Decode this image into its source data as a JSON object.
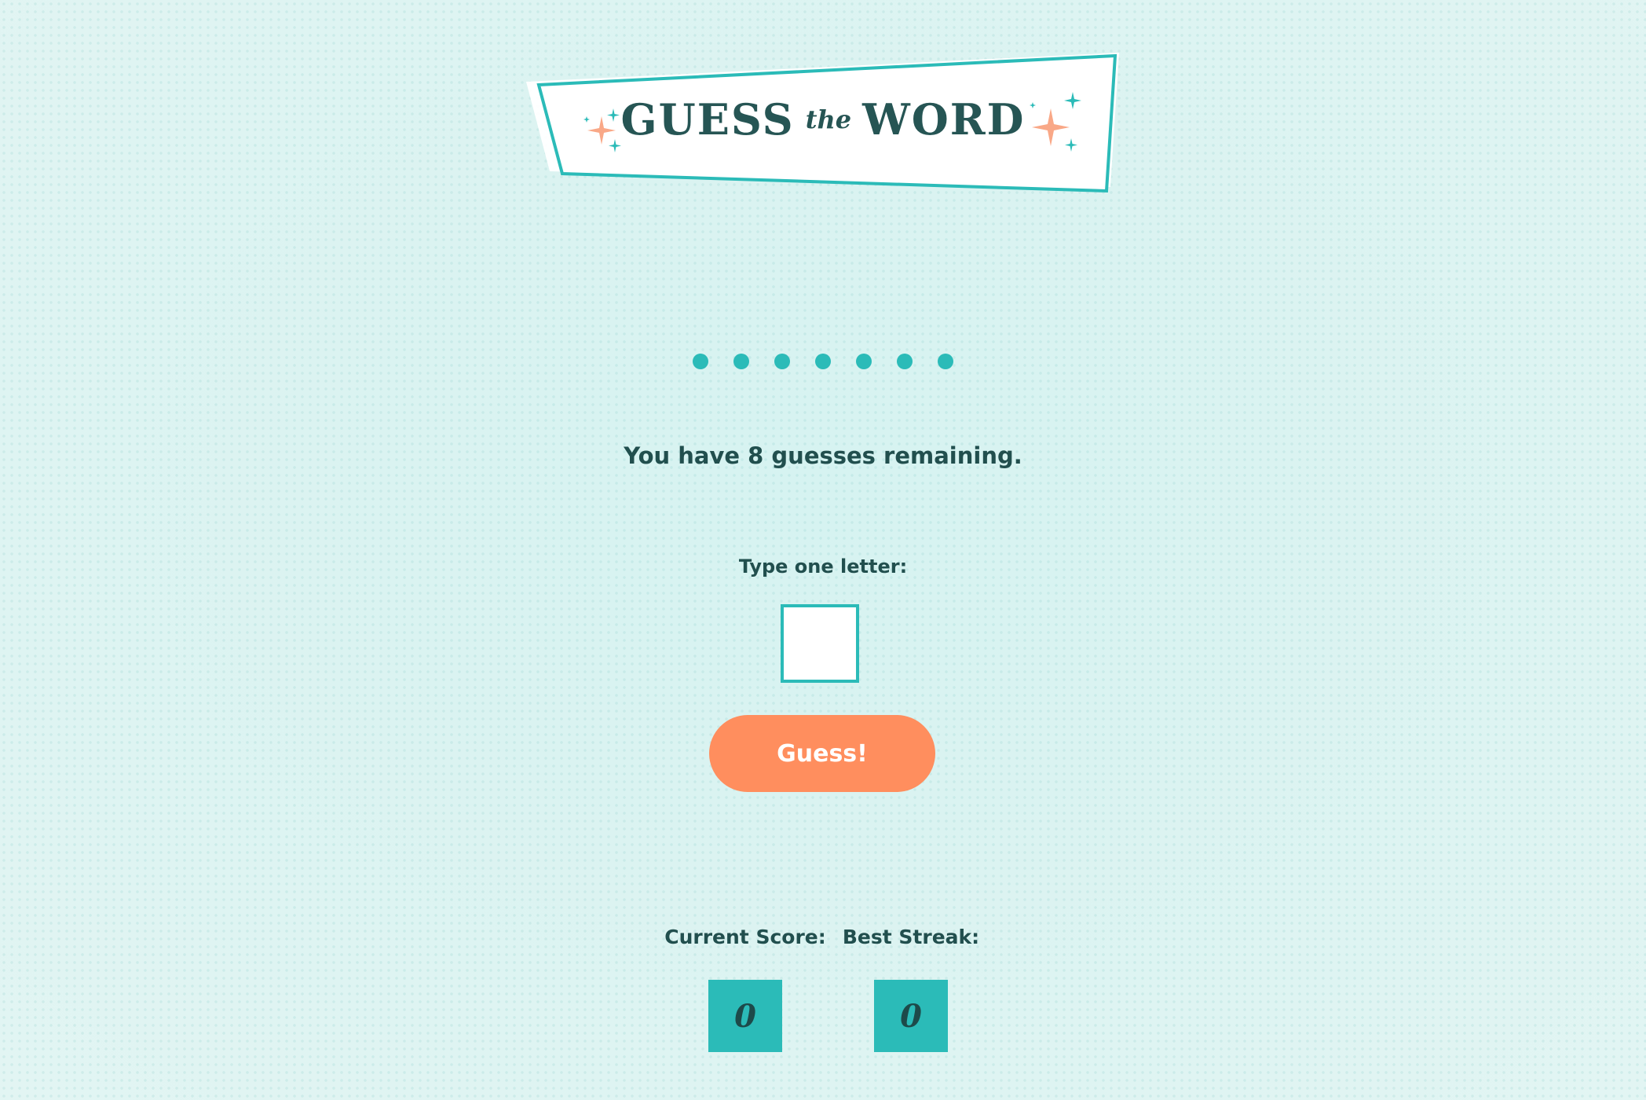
{
  "header": {
    "title_left": "GUESS",
    "title_middle": "the",
    "title_right": "WORD"
  },
  "word_progress": {
    "letters": [
      "•",
      "•",
      "•",
      "•",
      "•",
      "•",
      "•"
    ]
  },
  "status": {
    "remaining_text": "You have 8 guesses remaining."
  },
  "guess_form": {
    "label": "Type one letter:",
    "input_value": "",
    "button_label": "Guess!"
  },
  "scores": {
    "current_label": "Current Score:",
    "current_value": "0",
    "best_label": "Best Streak:",
    "best_value": "0"
  },
  "colors": {
    "accent": "#2bbbb8",
    "button": "#ff8e5e",
    "text": "#214f4e",
    "sparkle": "#f9a887"
  }
}
